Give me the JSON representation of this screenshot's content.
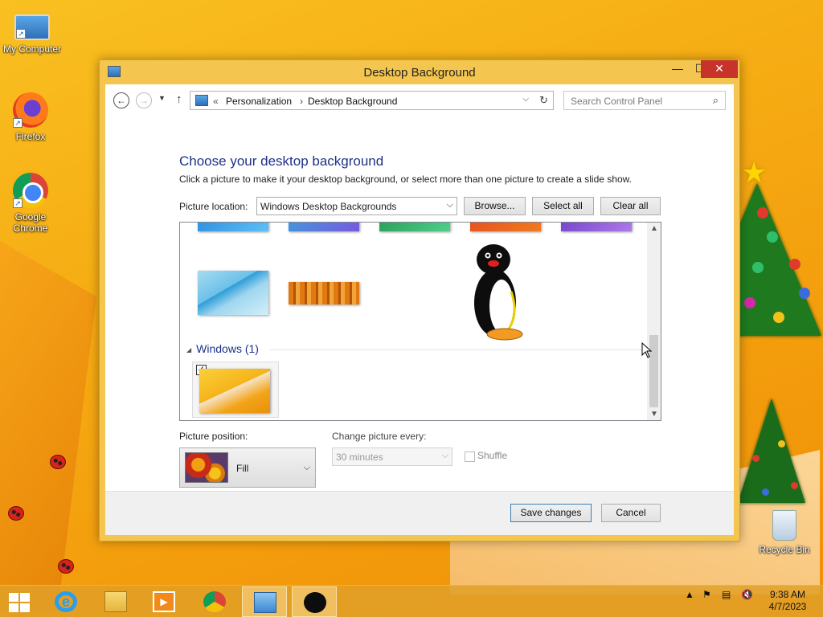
{
  "desktop": {
    "icons": [
      {
        "label": "My Computer"
      },
      {
        "label": "Firefox"
      },
      {
        "label": "Google Chrome"
      },
      {
        "label": "Recycle Bin"
      }
    ]
  },
  "window": {
    "title": "Desktop Background",
    "controls": {
      "minimize": "—",
      "maximize": "☐",
      "close": "✕"
    }
  },
  "nav": {
    "back_glyph": "←",
    "forward_glyph": "→",
    "recent_glyph": "▼",
    "up_glyph": "↑",
    "breadcrumb_prefix": "«",
    "breadcrumb": [
      "Personalization",
      "Desktop Background"
    ],
    "separator": "›",
    "search_placeholder": "Search Control Panel"
  },
  "content": {
    "heading": "Choose your desktop background",
    "subtitle": "Click a picture to make it your desktop background, or select more than one picture to create a slide show.",
    "picture_location_label": "Picture location:",
    "picture_location_value": "Windows Desktop Backgrounds",
    "browse_label": "Browse...",
    "select_all_label": "Select all",
    "clear_all_label": "Clear all",
    "group_label": "Windows (1)",
    "selected_check": "✓",
    "picture_position_label": "Picture position:",
    "picture_position_value": "Fill",
    "change_every_label": "Change picture every:",
    "change_every_value": "30 minutes",
    "shuffle_label": "Shuffle"
  },
  "footer": {
    "save_label": "Save changes",
    "cancel_label": "Cancel"
  },
  "taskbar": {
    "apps": [
      "start",
      "internet-explorer",
      "file-explorer",
      "media-player",
      "chrome",
      "control-panel",
      "pingu"
    ],
    "clock_time": "9:38 AM",
    "clock_date": "4/7/2023",
    "tray_expand": "▲"
  },
  "colors": {
    "accent_heading": "#1e3287",
    "window_frame": "#f4c64f",
    "close_button": "#c7322a"
  }
}
